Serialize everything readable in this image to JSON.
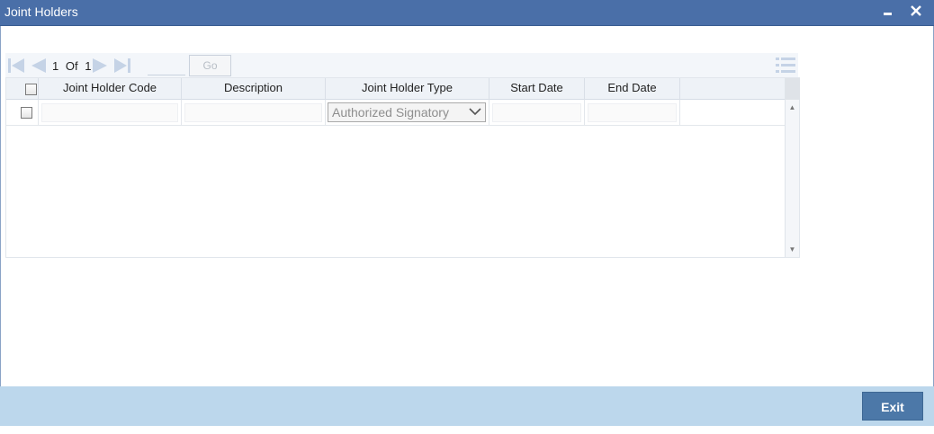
{
  "window": {
    "title": "Joint Holders",
    "minimize_glyph": "▬",
    "close_glyph": "✕"
  },
  "pager": {
    "current": "1",
    "of_label": "Of",
    "total": "1",
    "page_input_value": "",
    "go_label": "Go",
    "icons": [
      "first-page-icon",
      "previous-page-icon",
      "next-page-icon",
      "last-page-icon",
      "column-menu-icon"
    ]
  },
  "grid": {
    "columns": [
      "Joint Holder Code",
      "Description",
      "Joint Holder Type",
      "Start Date",
      "End Date"
    ],
    "rows": [
      {
        "selected": false,
        "joint_holder_code": "",
        "description": "",
        "joint_holder_type": "Authorized Signatory",
        "start_date": "",
        "end_date": ""
      }
    ],
    "scroll_up_glyph": "▲",
    "scroll_down_glyph": "▼"
  },
  "footer": {
    "exit_label": "Exit"
  },
  "colors": {
    "titlebar": "#4a6fa8",
    "footer": "#bcd7ec",
    "exit_button": "#4c78a8",
    "nav_icon": "#c5d3e6"
  }
}
